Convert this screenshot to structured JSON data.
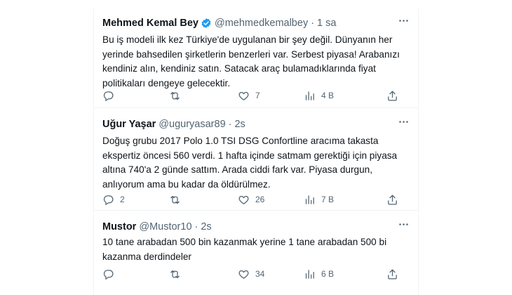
{
  "colors": {
    "text": "#0f1419",
    "muted": "#536471",
    "verified": "#1d9bf0",
    "border": "#eff3f4"
  },
  "tweets": [
    {
      "name": "Mehmed Kemal Bey",
      "verified": true,
      "handle": "@mehmedkemalbey",
      "dot": "·",
      "time": "1 sa",
      "text": "Bu iş modeli ilk kez Türkiye'de uygulanan bir şey değil. Dünyanın her yerinde bahsedilen şirketlerin benzerleri var. Serbest piyasa! Arabanızı kendiniz alın, kendiniz satın. Satacak araç bulamadıklarında fiyat politikaları dengeye gelecektir.",
      "replies": "",
      "retweets": "",
      "likes": "7",
      "views": "4 B"
    },
    {
      "name": "Uğur Yaşar",
      "verified": false,
      "handle": "@uguryasar89",
      "dot": "·",
      "time": "2s",
      "text": "Doğuş grubu 2017 Polo 1.0 TSI DSG Confortline aracıma takasta ekspertiz öncesi 560 verdi. 1 hafta içinde satmam gerektiği için piyasa altına 740'a 2 günde sattım. Arada ciddi fark var. Piyasa durgun, anlıyorum ama bu kadar da öldürülmez.",
      "replies": "2",
      "retweets": "",
      "likes": "26",
      "views": "7 B"
    },
    {
      "name": "Mustor",
      "verified": false,
      "handle": "@Mustor10",
      "dot": "·",
      "time": "2s",
      "text": "10 tane arabadan 500 bin kazanmak yerine 1 tane arabadan 500 bi kazanma derdindeler",
      "replies": "",
      "retweets": "",
      "likes": "34",
      "views": "6 B"
    }
  ],
  "icons": {
    "more": "more-dots-icon",
    "reply": "reply-icon",
    "retweet": "retweet-icon",
    "like": "heart-icon",
    "views": "views-chart-icon",
    "share": "share-icon",
    "verified": "verified-badge-icon"
  }
}
